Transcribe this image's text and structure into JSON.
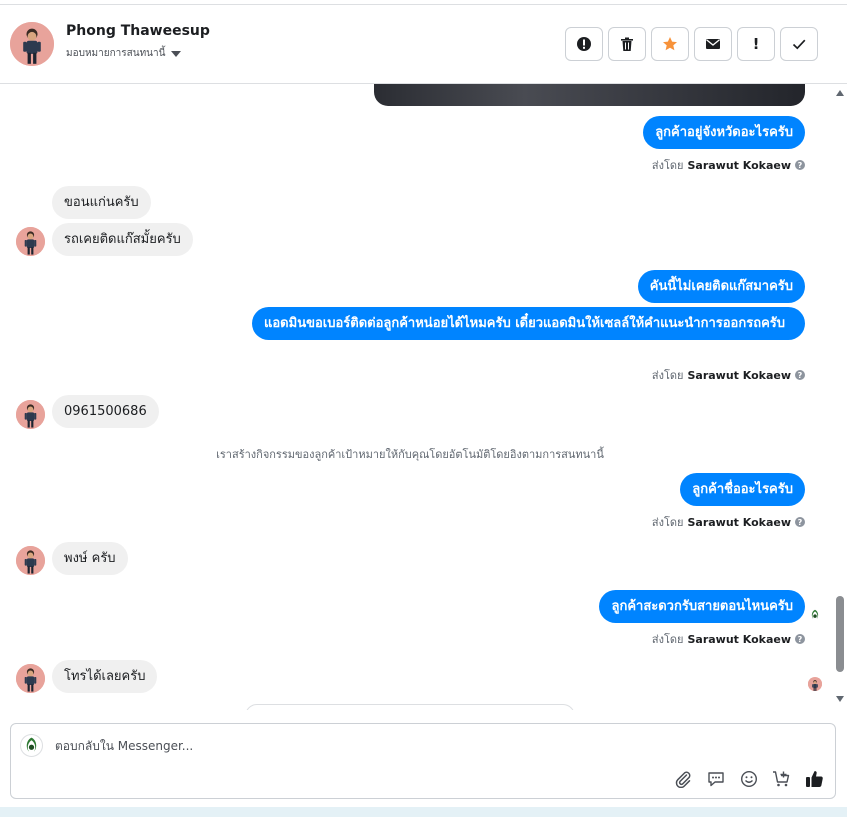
{
  "header": {
    "contact_name": "Phong Thaweesup",
    "assign_label": "มอบหมายการสนทนานี้",
    "actions": [
      {
        "name": "mark-spam-button",
        "icon": "alert-circle-icon"
      },
      {
        "name": "delete-button",
        "icon": "trash-icon"
      },
      {
        "name": "star-button",
        "icon": "star-icon"
      },
      {
        "name": "mark-unread-button",
        "icon": "envelope-icon"
      },
      {
        "name": "follow-up-button",
        "icon": "exclamation-icon",
        "label": "!"
      },
      {
        "name": "mark-done-button",
        "icon": "check-icon"
      }
    ],
    "star_color": "#f7923a"
  },
  "messages": [
    {
      "dir": "out",
      "text": "ลูกค้าอยู่จังหวัดอะไรครับ"
    },
    {
      "dir": "in",
      "text": "ขอนแก่นครับ"
    },
    {
      "dir": "in",
      "text": "รถเคยติดแก๊สมั้ยครับ"
    },
    {
      "dir": "out",
      "text": "คันนี้ไม่เคยติดแก๊สมาครับ"
    },
    {
      "dir": "out",
      "text": "แอดมินขอเบอร์ติดต่อลูกค้าหน่อยได้ไหมครับ เดี๋ยวแอดมินให้เซลล์ให้คำแนะนำการออกรถครับ"
    },
    {
      "dir": "in",
      "text": "0961500686"
    },
    {
      "dir": "out",
      "text": "ลูกค้าชื่ออะไรครับ"
    },
    {
      "dir": "in",
      "text": "พงษ์ ครับ"
    },
    {
      "dir": "out",
      "text": "ลูกค้าสะดวกรับสายตอนไหนครับ"
    },
    {
      "dir": "in",
      "text": "โทรได้เลยครับ"
    }
  ],
  "sent_by": {
    "prefix": "ส่งโดย",
    "name": "Sarawut Kokaew",
    "help": "?"
  },
  "system_message": "เราสร้างกิจกรรมของลูกค้าเป้าหมายให้กับคุณโดยอัตโนมัติโดยอิงตามการสนทนานี้",
  "composer": {
    "placeholder": "ตอบกลับใน Messenger...",
    "tools": [
      "attachment-icon",
      "saved-replies-icon",
      "emoji-icon",
      "cart-add-icon",
      "like-icon"
    ]
  },
  "colors": {
    "bubble_out": "#0084ff",
    "bubble_in": "#f0f0f0",
    "avatar_bg": "#e8a39b"
  }
}
